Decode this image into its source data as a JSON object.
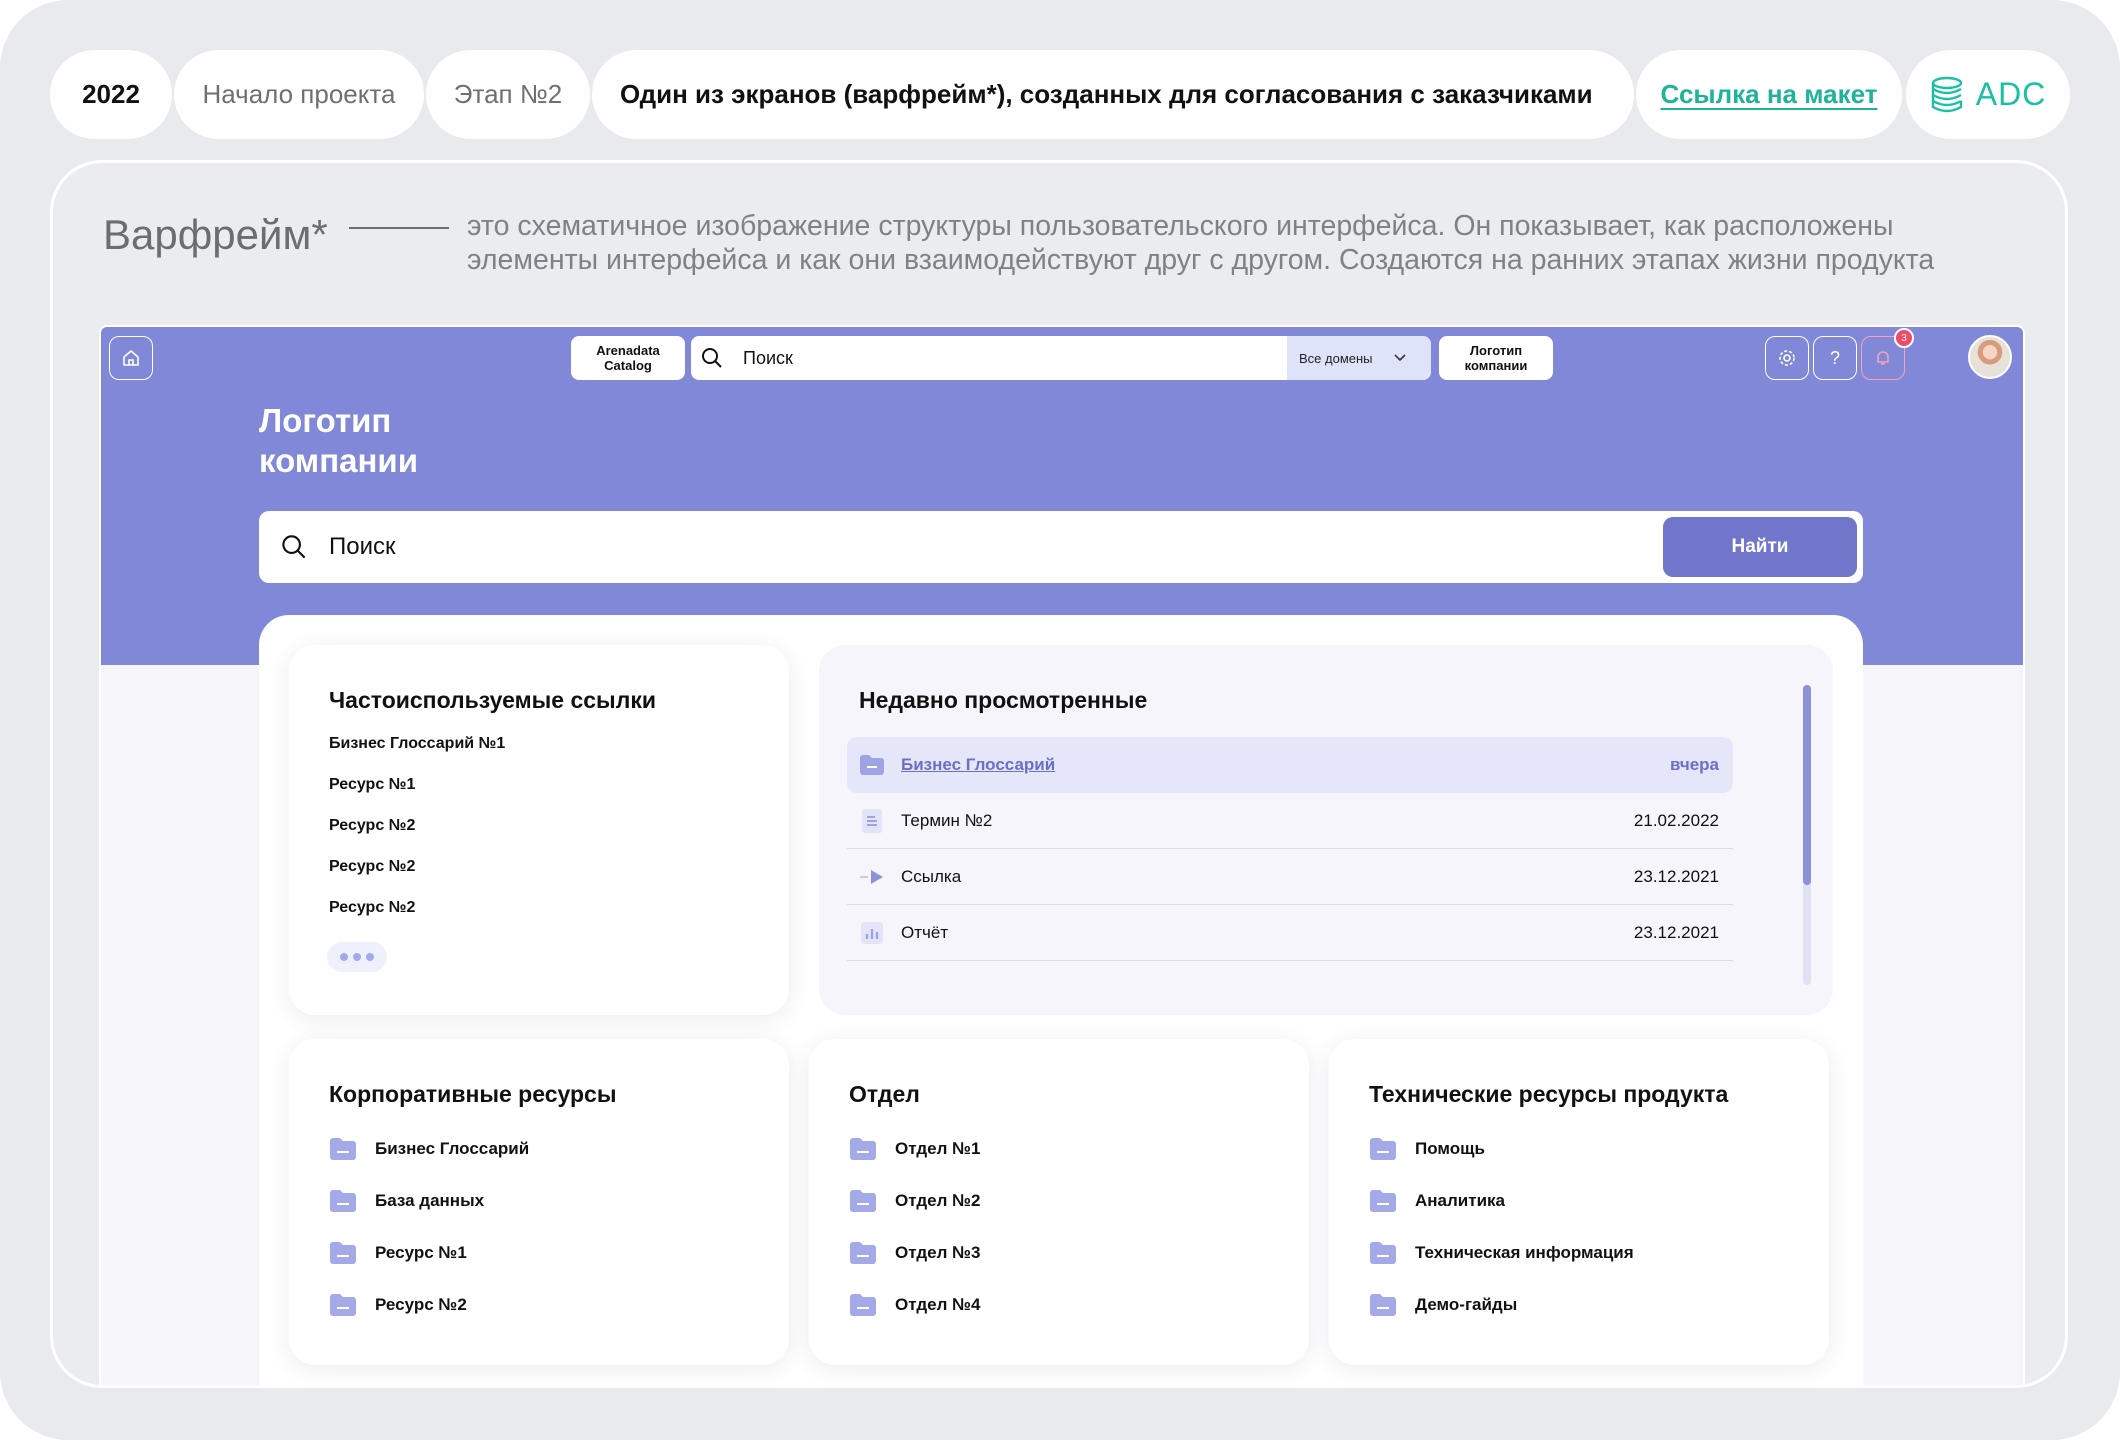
{
  "header": {
    "year": "2022",
    "project_start": "Начало проекта",
    "stage": "Этап №2",
    "description": "Один из экранов (варфрейм*), созданных для согласования с заказчиками",
    "mockup_link": "Ссылка  на макет",
    "brand_logo": "ADC"
  },
  "intro": {
    "term": "Варфрейм*",
    "description": "это схематичное изображение структуры пользовательского интерфейса. Он показывает, как расположены элементы интерфейса и как они взаимодействуют друг с другом. Создаются на ранних этапах жизни продукта"
  },
  "app": {
    "catalog_label_1": "Arenadata",
    "catalog_label_2": "Catalog",
    "top_search_placeholder": "Поиск",
    "domain_select": "Все домены",
    "company_logo_small_1": "Логотип",
    "company_logo_small_2": "компании",
    "notification_count": "3",
    "hero_logo_1": "Логотип",
    "hero_logo_2": "компании",
    "hero_search_placeholder": "Поиск",
    "find_button": "Найти",
    "frequent": {
      "title": "Частоиспользуемые ссылки",
      "items": [
        "Бизнес Глоссарий №1",
        "Ресурс №1",
        "Ресурс №2",
        "Ресурс №2",
        "Ресурс №2"
      ]
    },
    "recent": {
      "title": "Недавно просмотренные",
      "rows": [
        {
          "name": "Бизнес Глоссарий",
          "date": "вчера",
          "icon": "folder-icon"
        },
        {
          "name": "Термин №2",
          "date": "21.02.2022",
          "icon": "document-icon"
        },
        {
          "name": "Ссылка",
          "date": "23.12.2021",
          "icon": "link-icon"
        },
        {
          "name": "Отчёт",
          "date": "23.12.2021",
          "icon": "report-icon"
        }
      ]
    },
    "corporate": {
      "title": "Корпоративные ресурсы",
      "items": [
        "Бизнес Глоссарий",
        "База данных",
        "Ресурс №1",
        "Ресурс №2"
      ]
    },
    "department": {
      "title": "Отдел",
      "items": [
        "Отдел №1",
        "Отдел №2",
        "Отдел №3",
        "Отдел №4"
      ]
    },
    "technical": {
      "title": "Технические ресурсы продукта",
      "items": [
        "Помощь",
        "Аналитика",
        "Техническая информация",
        "Демо-гайды"
      ]
    }
  },
  "colors": {
    "hero": "#8088d7",
    "accent": "#7176cb",
    "link": "#1fb498",
    "badge": "#f04a6b"
  }
}
